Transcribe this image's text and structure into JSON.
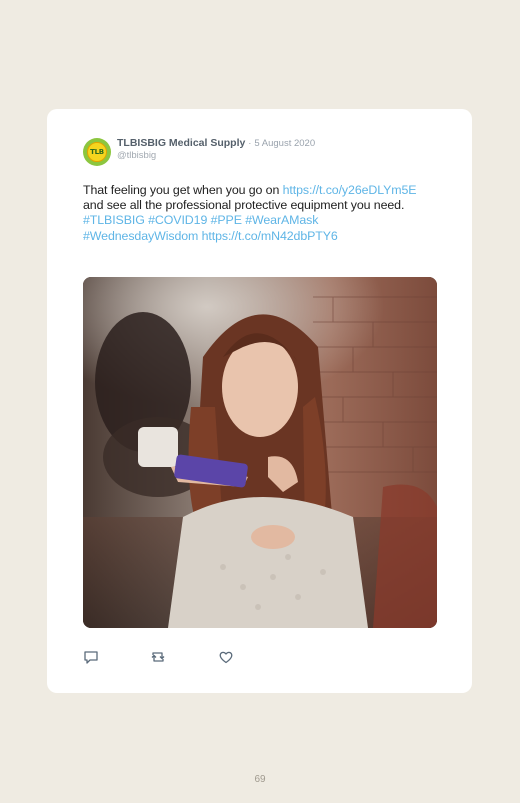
{
  "tweet": {
    "avatar_text": "TLB",
    "display_name": "TLBISBIG Medical Supply",
    "separator": "·",
    "date": "5 August 2020",
    "handle": "@tlbisbig",
    "text_parts": {
      "p1": "That feeling you get when you go on ",
      "link1": "https://t.co/y26eDLYm5E",
      "p2": " and see all the professional protective equipment you need. ",
      "tag1": "#TLBISBIG",
      "sp1": " ",
      "tag2": "#COVID19",
      "sp2": " ",
      "tag3": "#PPE",
      "sp3": " ",
      "tag4": "#WearAMask",
      "sp4": " ",
      "tag5": "#WednesdayWisdom",
      "sp5": " ",
      "link2": "https://t.co/mN42dbPTY6"
    },
    "actions": {
      "reply_icon": "reply-icon",
      "retweet_icon": "retweet-icon",
      "like_icon": "heart-icon"
    }
  },
  "colors": {
    "background": "#efebe2",
    "card": "#ffffff",
    "link": "#5fb5e6",
    "name": "#55606b",
    "muted": "#9aa3ad"
  },
  "page": {
    "number": "69"
  }
}
